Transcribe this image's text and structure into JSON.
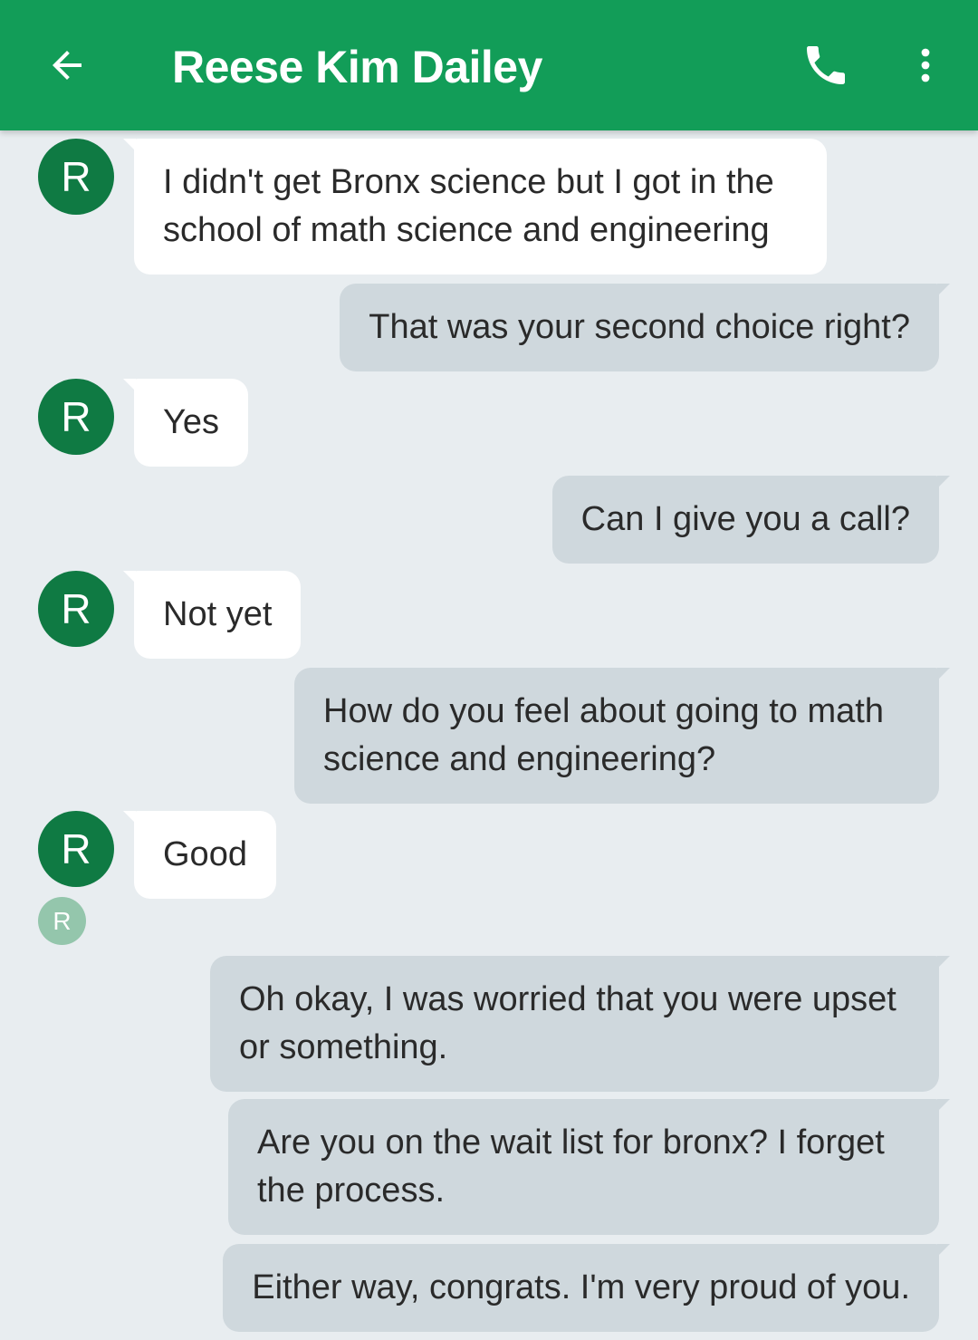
{
  "header": {
    "contact_name": "Reese Kim Dailey",
    "back_icon": "arrow-back-icon",
    "call_icon": "phone-icon",
    "menu_icon": "more-vert-icon",
    "background_color": "#129d58"
  },
  "contact": {
    "avatar_letter": "R",
    "avatar_color": "#0f7a43"
  },
  "read_receipt": {
    "letter": "R"
  },
  "messages": [
    {
      "direction": "incoming",
      "text": "I didn't get Bronx science but I got in the school of math science and engineering"
    },
    {
      "direction": "outgoing",
      "text": "That was your second choice right?"
    },
    {
      "direction": "incoming",
      "text": "Yes"
    },
    {
      "direction": "outgoing",
      "text": "Can I give you a call?"
    },
    {
      "direction": "incoming",
      "text": "Not yet"
    },
    {
      "direction": "outgoing",
      "text": "How do you feel about going to math science and engineering?"
    },
    {
      "direction": "incoming",
      "text": "Good"
    },
    {
      "direction": "outgoing",
      "text": "Oh okay, I was worried that you were upset or something."
    },
    {
      "direction": "outgoing",
      "text": "Are you on the wait list for bronx? I forget the process."
    },
    {
      "direction": "outgoing",
      "text": "Either way, congrats. I'm very proud of you."
    }
  ]
}
